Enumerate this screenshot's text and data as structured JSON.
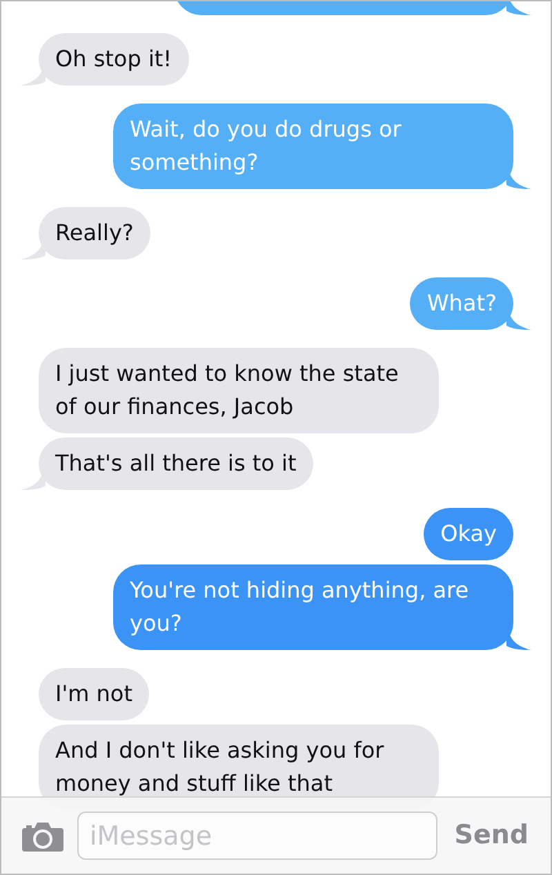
{
  "messages": [
    {
      "kind": "sent",
      "color": "#55aff7",
      "tail": true
    },
    {
      "kind": "received",
      "text": "Oh stop it!",
      "tail": true
    },
    {
      "kind": "sent",
      "color": "#55aff7",
      "text": "Wait, do you do drugs or something?",
      "tail": true
    },
    {
      "kind": "received",
      "text": "Really?",
      "tail": true
    },
    {
      "kind": "sent",
      "color": "#55aff7",
      "text": "What?",
      "tail": true
    },
    {
      "kind": "received",
      "text": "I just wanted to know the state of our finances, Jacob",
      "tail": false
    },
    {
      "kind": "received",
      "text": "That's all there is to it",
      "tail": true
    },
    {
      "kind": "sent",
      "color": "#3b93f6",
      "text": "Okay",
      "tail": false
    },
    {
      "kind": "sent",
      "color": "#3b93f6",
      "text": "You're not hiding anything, are you?",
      "tail": true
    },
    {
      "kind": "received",
      "text": "I'm not",
      "tail": false
    },
    {
      "kind": "received",
      "text": "And I don't like asking you for money and stuff like that",
      "tail": false
    }
  ],
  "composer": {
    "placeholder": "iMessage",
    "send": "Send"
  }
}
